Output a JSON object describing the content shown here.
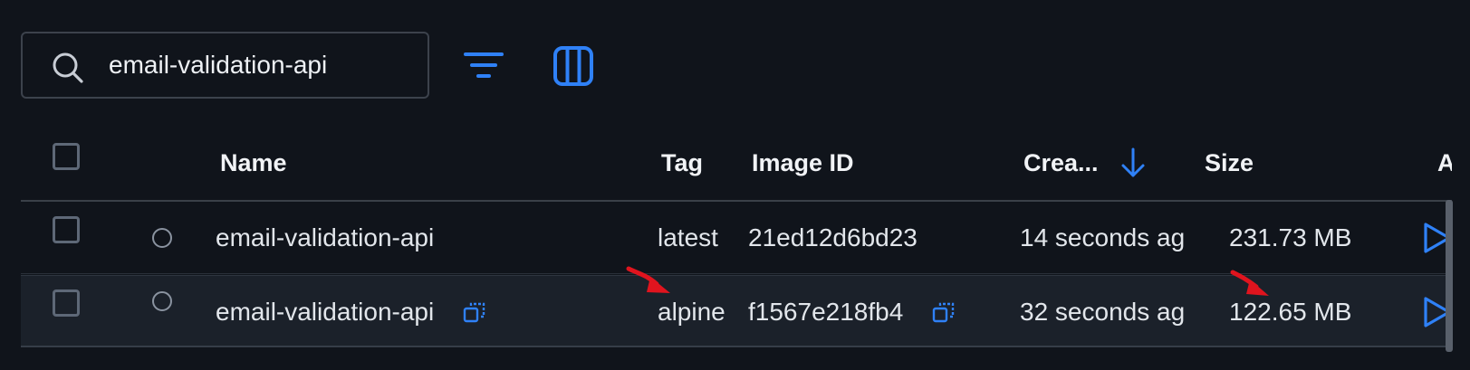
{
  "search": {
    "value": "email-validation-api",
    "icon": "search-icon"
  },
  "toolbar": {
    "filter_icon": "filter-icon",
    "columns_icon": "columns-icon"
  },
  "table": {
    "columns": {
      "name": "Name",
      "tag": "Tag",
      "image_id": "Image ID",
      "created": "Crea...",
      "size": "Size",
      "actions": "Ac"
    },
    "sort": {
      "column": "created",
      "direction": "descending",
      "icon": "arrow-down-icon"
    },
    "rows": [
      {
        "name": "email-validation-api",
        "tag": "latest",
        "image_id": "21ed12d6bd23",
        "created": "14 seconds ag",
        "size": "231.73 MB",
        "has_copy_icons": false
      },
      {
        "name": "email-validation-api",
        "tag": "alpine",
        "image_id": "f1567e218fb4",
        "created": "32 seconds ag",
        "size": "122.65 MB",
        "has_copy_icons": true
      }
    ]
  },
  "colors": {
    "accent": "#2f81f7",
    "background": "#10141b",
    "annotation": "#e0141e"
  }
}
